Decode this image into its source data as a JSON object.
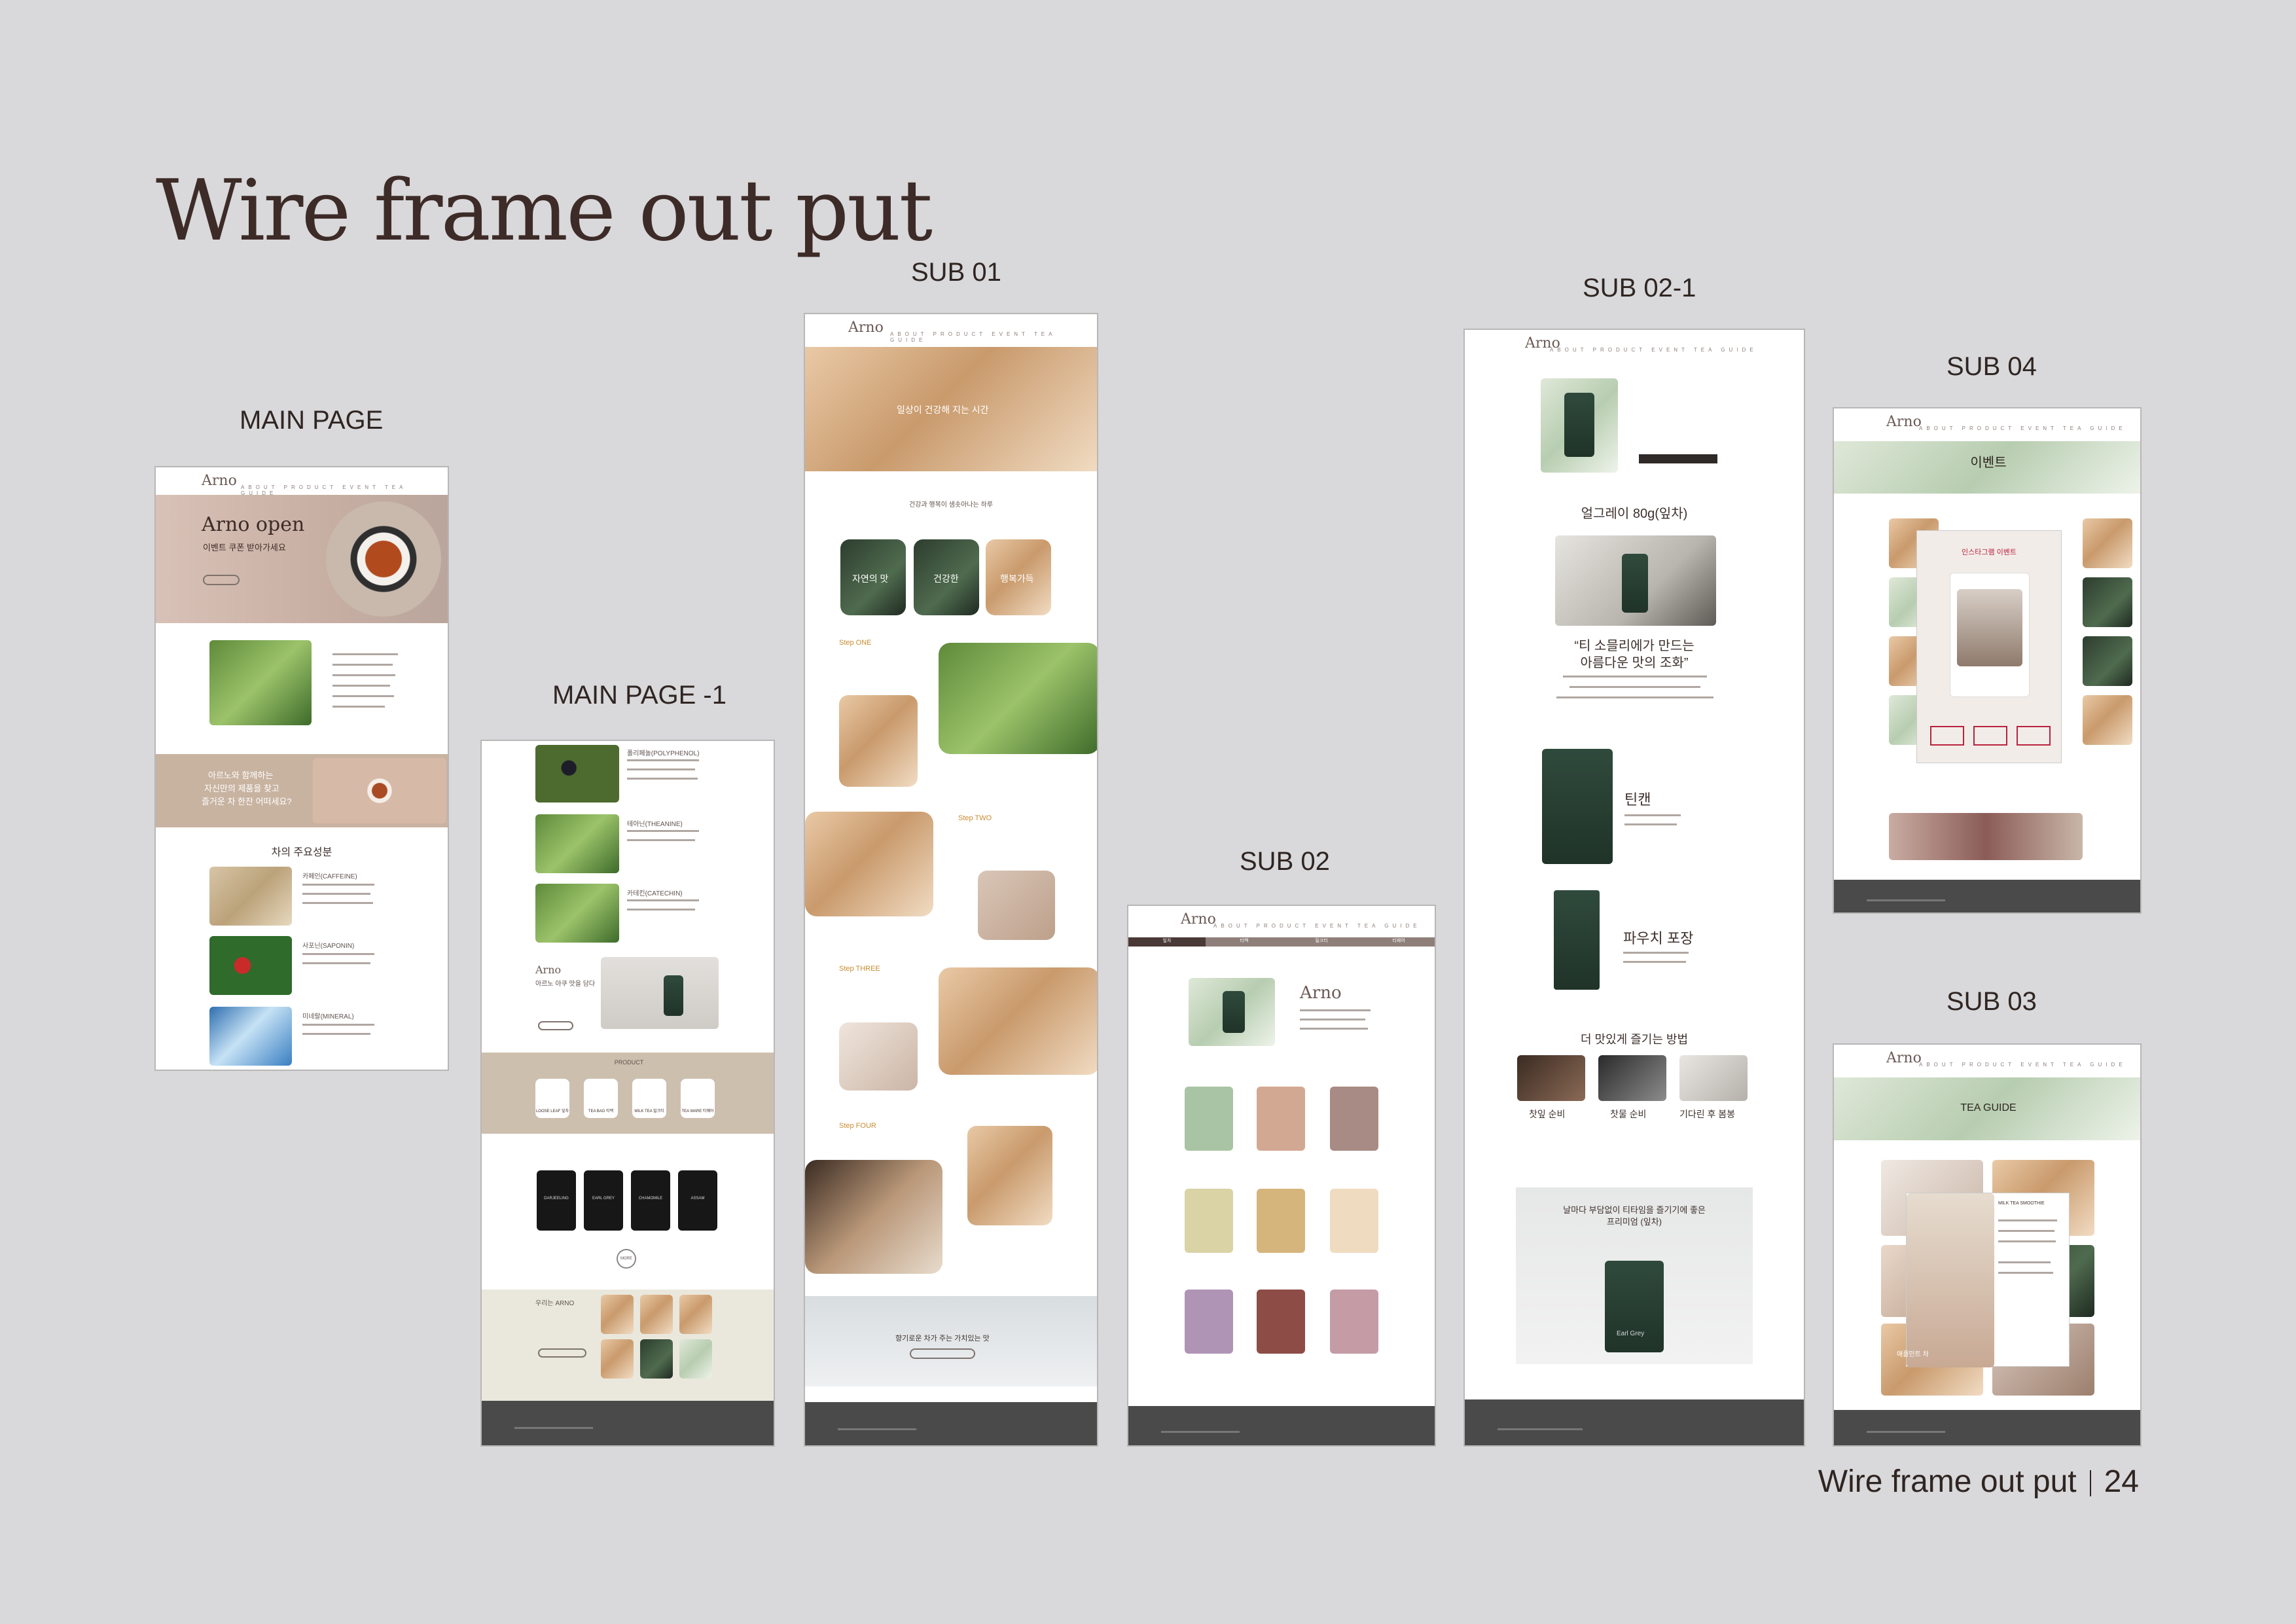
{
  "heading": "Wire frame out put",
  "labels": {
    "main_page": "MAIN PAGE",
    "main_page_1": "MAIN PAGE -1",
    "sub01": "SUB 01",
    "sub02": "SUB 02",
    "sub02_1": "SUB 02-1",
    "sub04": "SUB 04",
    "sub03": "SUB 03"
  },
  "main_page": {
    "logo": "Arno",
    "hero_title": "Arno open",
    "hero_sub": "이벤트 쿠폰 받아가세요",
    "band_text_1": "아르노와 함께하는",
    "band_text_2": "자신만의 제품을 찾고",
    "band_text_3": "즐거운 차 한잔 어떠세요?",
    "ingredients_title": "차의 주요성분",
    "ingredients": [
      "카페인(CAFFEINE)",
      "사포닌(SAPONIN)",
      "미네랄(MINERAL)"
    ]
  },
  "main_page_1": {
    "items": [
      "폴리페놀(POLYPHENOL)",
      "테아닌(THEANINE)",
      "카테킨(CATECHIN)"
    ],
    "promo_logo": "Arno",
    "promo_text": "아르노 아쿠 맛을 담다",
    "product_title": "PRODUCT",
    "product_items": [
      "LOOSE LEAF 잎차",
      "TEA BAG 티백",
      "MILK TEA 밀크티",
      "TEA WARE 티웨어"
    ],
    "dark_items": [
      "DARJEELING",
      "EARL GREY",
      "CHAMOMILE",
      "ASSAM"
    ],
    "more": "MORE",
    "bottom_title": "우리는 ARNO"
  },
  "sub01": {
    "logo": "Arno",
    "hero_text": "일상이 건강해 지는 시간",
    "intro": "건강과 행복이 샘솟아나는 하루",
    "circles": [
      "자연의 맛",
      "건강한",
      "행복가득"
    ],
    "steps": [
      "Step ONE",
      "Step TWO",
      "Step THREE",
      "Step FOUR"
    ],
    "bottom_text": "향기로운 차가 주는 가치있는 맛"
  },
  "sub02": {
    "logo": "Arno",
    "tabs": [
      "잎차",
      "티백",
      "밀크티",
      "티웨어"
    ],
    "brand": "Arno"
  },
  "sub02_1": {
    "logo": "Arno",
    "product_name": "얼그레이 80g(잎차)",
    "quote_1": "“티 소믈리에가 만드는",
    "quote_2": "아름다운 맛의 조화”",
    "tin_title": "틴캔",
    "pouch_title": "파우치 포장",
    "howto_title": "더 맛있게 즐기는 방법",
    "howto": [
      "찻잎 순비",
      "찻물 순비",
      "기다린 후 봄봉"
    ],
    "banner_1": "날마다 부담없이 티타임을 즐기기에 좋은",
    "banner_2": "프리미엄 (잎차)",
    "tin_label": "Earl Grey"
  },
  "sub04": {
    "logo": "Arno",
    "title": "이벤트",
    "popup_title": "인스타그램 이벤트"
  },
  "sub03": {
    "logo": "Arno",
    "title": "TEA GUIDE",
    "popup_title": "MILK TEA SMOOTHIE",
    "caption": "애플민트 차"
  },
  "footer_page": {
    "title": "Wire frame out put",
    "number": "24"
  }
}
